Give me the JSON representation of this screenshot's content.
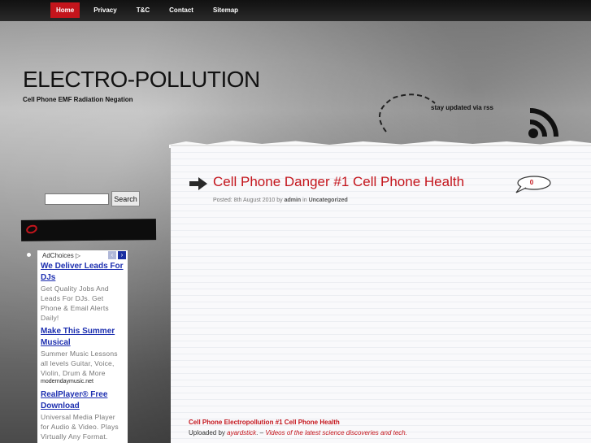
{
  "nav": {
    "items": [
      "Home",
      "Privacy",
      "T&C",
      "Contact",
      "Sitemap"
    ],
    "active": "Home"
  },
  "header": {
    "title": "ELECTRO-POLLUTION",
    "tagline": "Cell Phone EMF Radiation Negation",
    "rss_text": "stay updated via rss",
    "rss_icon": "rss-icon"
  },
  "sidebar": {
    "search_value": "",
    "search_button": "Search",
    "ad_choices": "AdChoices",
    "ads": [
      {
        "title": "We Deliver Leads For DJs",
        "text": "Get Quality Jobs And Leads For DJs. Get Phone & Email Alerts Daily!",
        "url": ""
      },
      {
        "title": "Make This Summer Musical",
        "text": "Summer Music Lessons all levels Guitar, Voice, Violin, Drum & More",
        "url": "moderndaymusic.net"
      },
      {
        "title": "RealPlayer® Free Download",
        "text": "Universal Media Player for Audio & Video. Plays Virtually Any Format.",
        "url": ""
      }
    ]
  },
  "post": {
    "title": "Cell Phone Danger #1 Cell Phone Health",
    "meta_prefix": "Posted: 8th August 2010 by",
    "author": "admin",
    "meta_in": "in",
    "category": "Uncategorized",
    "comment_count": "0",
    "video_caption": "Cell Phone Electropollution #1 Cell Phone Health",
    "uploaded_by": "Uploaded by",
    "uploader": "ayardstick",
    "separator": ". –",
    "video_link": "Videos of the latest science discoveries and tech."
  },
  "colors": {
    "accent": "#c4151c",
    "ad_link": "#1d2fb0"
  }
}
